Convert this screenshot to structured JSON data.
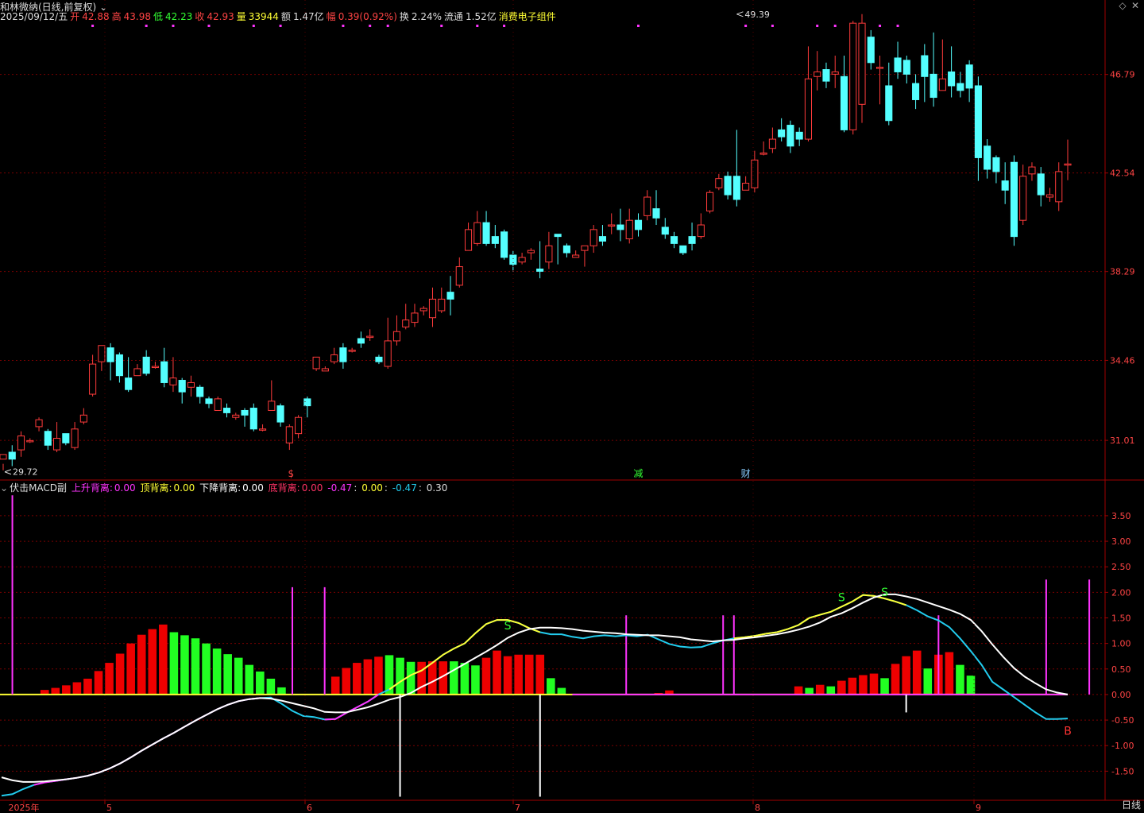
{
  "header": {
    "stock_name": "和林微纳(日线,前复权)",
    "date": "2025/09/12/五",
    "open_label": "开",
    "open": "42.88",
    "high_label": "高",
    "high": "43.98",
    "low_label": "低",
    "low": "42.23",
    "close_label": "收",
    "close": "42.93",
    "vol_label": "量",
    "vol": "33944",
    "amt_label": "额",
    "amt": "1.47亿",
    "chg_label": "幅",
    "chg": "0.39(0.92%)",
    "turn_label": "换",
    "turn": "2.24%",
    "float_label": "流通",
    "float": "1.52亿",
    "sector": "消费电子组件"
  },
  "indicator": {
    "name": "伏击MACD副",
    "up_div_label": "上升背离:",
    "up_div": "0.00",
    "top_div_label": "顶背离:",
    "top_div": "0.00",
    "down_div_label": "下降背离:",
    "down_div": "0.00",
    "bottom_div_label": "底背离:",
    "bottom_div": "0.00",
    "v1": "-0.47",
    "v2": "0.00",
    "v3": "-0.47",
    "v4": "0.30"
  },
  "period_label": "日线",
  "colors": {
    "up": "#ff3b3b",
    "down": "#54ffff",
    "grid": "#7a0000",
    "axis_text": "#ff4444",
    "line_white": "#ffffff",
    "line_cyan": "#22ccee",
    "line_magenta": "#ff33ff",
    "line_yellow": "#ffff33",
    "bar_green": "#22ff22",
    "bar_red": "#ee0000"
  },
  "chart_data": [
    {
      "type": "candlestick",
      "title": "和林微纳(日线,前复权)",
      "y_ticks": [
        31.01,
        34.46,
        38.29,
        42.54,
        46.79
      ],
      "ylim": [
        29.3,
        50.0
      ],
      "x_ticks": [
        "2025年",
        "5",
        "6",
        "7",
        "8",
        "9"
      ],
      "annotations": [
        {
          "text": "49.39",
          "kind": "max"
        },
        {
          "text": "29.72",
          "kind": "min"
        },
        {
          "text": "$",
          "kind": "event"
        },
        {
          "text": "减",
          "kind": "event"
        },
        {
          "text": "财",
          "kind": "event"
        }
      ],
      "candles": [
        [
          30.2,
          30.4,
          29.72,
          30.0
        ],
        [
          30.5,
          30.2,
          29.9,
          30.8
        ],
        [
          30.6,
          31.2,
          30.3,
          31.4
        ],
        [
          31.0,
          31.0,
          30.9,
          31.1
        ],
        [
          31.6,
          31.9,
          31.4,
          32.0
        ],
        [
          31.4,
          30.8,
          30.6,
          31.5
        ],
        [
          30.6,
          31.1,
          30.5,
          31.8
        ],
        [
          31.3,
          30.9,
          30.8,
          31.3
        ],
        [
          30.7,
          31.5,
          30.6,
          31.8
        ],
        [
          31.8,
          32.1,
          31.7,
          32.4
        ],
        [
          33.0,
          34.3,
          32.9,
          34.7
        ],
        [
          34.4,
          35.1,
          34.0,
          35.1
        ],
        [
          35.0,
          34.4,
          33.6,
          35.2
        ],
        [
          34.7,
          33.8,
          33.5,
          34.8
        ],
        [
          33.7,
          33.2,
          33.1,
          34.6
        ],
        [
          33.8,
          34.1,
          33.8,
          34.3
        ],
        [
          34.6,
          33.9,
          33.8,
          34.9
        ],
        [
          34.2,
          34.2,
          34.1,
          34.4
        ],
        [
          34.4,
          33.5,
          33.3,
          35.0
        ],
        [
          33.4,
          33.7,
          33.1,
          34.6
        ],
        [
          33.6,
          33.1,
          32.6,
          33.7
        ],
        [
          33.3,
          33.5,
          32.9,
          33.8
        ],
        [
          33.3,
          32.9,
          32.6,
          33.4
        ],
        [
          32.8,
          32.6,
          32.4,
          32.9
        ],
        [
          32.3,
          32.8,
          32.3,
          32.9
        ],
        [
          32.4,
          32.2,
          32.0,
          32.6
        ],
        [
          32.0,
          32.1,
          31.9,
          32.2
        ],
        [
          32.3,
          32.1,
          31.6,
          32.4
        ],
        [
          32.4,
          31.5,
          31.4,
          32.6
        ],
        [
          31.5,
          31.5,
          31.4,
          31.7
        ],
        [
          32.3,
          32.7,
          32.3,
          33.6
        ],
        [
          32.5,
          31.8,
          31.6,
          32.6
        ],
        [
          30.9,
          31.6,
          30.6,
          31.7
        ],
        [
          31.3,
          32.0,
          31.1,
          32.1
        ],
        [
          32.8,
          32.5,
          32.0,
          32.9
        ],
        [
          34.1,
          34.6,
          34.0,
          34.6
        ],
        [
          34.0,
          34.1,
          34.0,
          34.2
        ],
        [
          34.4,
          34.7,
          34.3,
          35.0
        ],
        [
          35.0,
          34.4,
          34.1,
          35.2
        ],
        [
          34.9,
          34.9,
          34.8,
          35.0
        ],
        [
          35.4,
          35.2,
          35.0,
          35.7
        ],
        [
          35.5,
          35.5,
          35.3,
          35.8
        ],
        [
          34.6,
          34.4,
          34.3,
          34.7
        ],
        [
          34.2,
          35.3,
          34.1,
          36.3
        ],
        [
          35.3,
          35.7,
          35.1,
          36.4
        ],
        [
          35.9,
          36.2,
          35.8,
          36.9
        ],
        [
          36.1,
          36.5,
          35.9,
          36.9
        ],
        [
          36.6,
          36.7,
          36.4,
          36.8
        ],
        [
          36.3,
          37.1,
          35.9,
          37.6
        ],
        [
          36.6,
          37.1,
          36.5,
          37.6
        ],
        [
          37.4,
          37.1,
          36.4,
          38.1
        ],
        [
          37.7,
          38.5,
          37.6,
          38.9
        ],
        [
          39.2,
          40.1,
          39.2,
          40.4
        ],
        [
          39.5,
          40.4,
          39.4,
          40.9
        ],
        [
          40.4,
          39.5,
          39.4,
          40.9
        ],
        [
          39.8,
          39.5,
          39.3,
          40.3
        ],
        [
          40.0,
          38.9,
          38.8,
          40.1
        ],
        [
          39.0,
          38.6,
          38.3,
          39.2
        ],
        [
          38.7,
          38.9,
          38.6,
          39.1
        ],
        [
          39.1,
          39.2,
          38.8,
          39.3
        ],
        [
          38.4,
          38.3,
          38.0,
          39.6
        ],
        [
          38.7,
          39.4,
          38.4,
          40.0
        ],
        [
          39.9,
          39.8,
          38.6,
          39.8
        ],
        [
          39.4,
          39.1,
          38.9,
          39.5
        ],
        [
          38.9,
          39.0,
          38.9,
          39.2
        ],
        [
          39.2,
          39.4,
          38.5,
          39.3
        ],
        [
          39.4,
          40.1,
          39.1,
          40.3
        ],
        [
          39.8,
          39.6,
          39.4,
          40.3
        ],
        [
          40.3,
          40.3,
          39.9,
          40.8
        ],
        [
          40.3,
          40.1,
          39.6,
          41.0
        ],
        [
          39.7,
          40.5,
          39.5,
          41.0
        ],
        [
          40.5,
          40.1,
          39.8,
          40.8
        ],
        [
          40.7,
          41.5,
          40.5,
          41.8
        ],
        [
          41.0,
          40.6,
          40.3,
          41.8
        ],
        [
          40.2,
          39.9,
          39.7,
          40.6
        ],
        [
          39.8,
          39.5,
          39.3,
          40.0
        ],
        [
          39.4,
          39.1,
          39.0,
          39.4
        ],
        [
          39.8,
          39.5,
          39.2,
          40.4
        ],
        [
          39.8,
          40.3,
          39.7,
          40.8
        ],
        [
          40.9,
          41.7,
          40.8,
          41.8
        ],
        [
          41.9,
          42.3,
          41.8,
          42.5
        ],
        [
          42.4,
          41.6,
          41.4,
          42.6
        ],
        [
          42.4,
          41.4,
          41.1,
          44.4
        ],
        [
          41.8,
          42.1,
          41.8,
          42.4
        ],
        [
          41.9,
          43.1,
          41.7,
          43.5
        ],
        [
          43.4,
          43.4,
          43.3,
          43.9
        ],
        [
          43.6,
          44.0,
          43.4,
          44.5
        ],
        [
          44.4,
          44.1,
          43.9,
          44.9
        ],
        [
          44.6,
          43.7,
          43.4,
          44.8
        ],
        [
          44.3,
          44.0,
          43.7,
          44.5
        ],
        [
          44.0,
          46.6,
          43.9,
          48.0
        ],
        [
          46.7,
          46.9,
          46.1,
          47.8
        ],
        [
          47.0,
          46.5,
          46.2,
          47.3
        ],
        [
          46.8,
          46.9,
          46.2,
          47.6
        ],
        [
          46.7,
          44.4,
          44.3,
          47.6
        ],
        [
          44.4,
          49.0,
          44.2,
          49.1
        ],
        [
          45.5,
          49.0,
          44.7,
          49.39
        ],
        [
          48.4,
          47.3,
          47.0,
          48.7
        ],
        [
          47.1,
          47.1,
          45.5,
          47.6
        ],
        [
          46.3,
          44.8,
          44.6,
          47.3
        ],
        [
          47.5,
          46.9,
          46.6,
          48.2
        ],
        [
          47.4,
          46.8,
          46.4,
          47.6
        ],
        [
          46.4,
          45.7,
          45.3,
          46.8
        ],
        [
          47.6,
          46.7,
          45.6,
          48.1
        ],
        [
          46.8,
          45.8,
          45.4,
          48.6
        ],
        [
          46.1,
          46.6,
          46.1,
          48.3
        ],
        [
          46.9,
          46.3,
          45.8,
          48.0
        ],
        [
          46.4,
          46.1,
          45.8,
          46.9
        ],
        [
          47.2,
          46.2,
          45.6,
          47.4
        ],
        [
          46.3,
          43.2,
          42.2,
          46.7
        ],
        [
          43.7,
          42.7,
          42.3,
          44.0
        ],
        [
          43.2,
          42.6,
          42.1,
          43.3
        ],
        [
          42.2,
          41.8,
          41.2,
          43.0
        ],
        [
          43.0,
          39.8,
          39.4,
          43.3
        ],
        [
          40.5,
          42.4,
          40.3,
          42.9
        ],
        [
          42.5,
          42.8,
          42.2,
          43.0
        ],
        [
          42.5,
          41.6,
          41.1,
          42.8
        ],
        [
          41.5,
          41.6,
          41.3,
          41.9
        ],
        [
          41.3,
          42.6,
          40.9,
          43.0
        ],
        [
          42.88,
          42.93,
          42.23,
          43.98
        ]
      ]
    },
    {
      "type": "macd",
      "title": "伏击MACD副",
      "y_ticks": [
        -1.5,
        -1.0,
        -0.5,
        0.0,
        0.5,
        1.0,
        1.5,
        2.0,
        2.5,
        3.0,
        3.5
      ],
      "ylim": [
        -2.07,
        3.95
      ],
      "annotations": [
        "S",
        "S",
        "S",
        "B"
      ],
      "n": 100,
      "diff_white": [
        -1.62,
        -1.68,
        -1.71,
        -1.71,
        -1.7,
        -1.68,
        -1.66,
        -1.63,
        -1.59,
        -1.53,
        -1.45,
        -1.35,
        -1.23,
        -1.1,
        -0.98,
        -0.86,
        -0.75,
        -0.63,
        -0.51,
        -0.4,
        -0.29,
        -0.2,
        -0.13,
        -0.09,
        -0.07,
        -0.08,
        -0.12,
        -0.17,
        -0.22,
        -0.27,
        -0.34,
        -0.35,
        -0.35,
        -0.3,
        -0.25,
        -0.18,
        -0.1,
        -0.05,
        0.03,
        0.15,
        0.25,
        0.36,
        0.48,
        0.6,
        0.72,
        0.84,
        0.97,
        1.11,
        1.21,
        1.28,
        1.31,
        1.31,
        1.3,
        1.28,
        1.25,
        1.23,
        1.21,
        1.2,
        1.18,
        1.17,
        1.16,
        1.16,
        1.14,
        1.12,
        1.08,
        1.06,
        1.04,
        1.06,
        1.07,
        1.1,
        1.12,
        1.15,
        1.18,
        1.22,
        1.27,
        1.33,
        1.41,
        1.52,
        1.59,
        1.69,
        1.8,
        1.9,
        1.96,
        1.96,
        1.92,
        1.87,
        1.8,
        1.73,
        1.66,
        1.58,
        1.46,
        1.24,
        0.98,
        0.74,
        0.52,
        0.35,
        0.22,
        0.1,
        0.04,
        0.0
      ],
      "dea_cyan": [
        -1.98,
        -1.95,
        -1.85,
        -1.77,
        -1.72,
        -1.69,
        -1.66,
        -1.63,
        -1.59,
        -1.53,
        -1.45,
        -1.35,
        -1.23,
        -1.1,
        -0.98,
        -0.86,
        -0.75,
        -0.63,
        -0.51,
        -0.4,
        -0.29,
        -0.2,
        -0.13,
        -0.09,
        -0.07,
        -0.06,
        -0.18,
        -0.32,
        -0.42,
        -0.44,
        -0.49,
        -0.48,
        -0.36,
        -0.25,
        -0.14,
        0.0,
        0.1,
        0.25,
        0.38,
        0.47,
        0.62,
        0.78,
        0.9,
        1.0,
        1.2,
        1.38,
        1.46,
        1.46,
        1.4,
        1.3,
        1.22,
        1.18,
        1.18,
        1.13,
        1.1,
        1.14,
        1.16,
        1.14,
        1.16,
        1.14,
        1.17,
        1.08,
        0.99,
        0.94,
        0.92,
        0.93,
        1.0,
        1.06,
        1.1,
        1.12,
        1.15,
        1.19,
        1.22,
        1.28,
        1.36,
        1.5,
        1.56,
        1.62,
        1.72,
        1.82,
        1.95,
        1.93,
        1.88,
        1.82,
        1.75,
        1.65,
        1.53,
        1.45,
        1.32,
        1.1,
        0.85,
        0.58,
        0.25,
        0.1,
        -0.05,
        -0.2,
        -0.35,
        -0.48,
        -0.48,
        -0.47
      ],
      "hist": [
        0.0,
        0.0,
        0.0,
        0.0,
        0.09,
        0.13,
        0.18,
        0.24,
        0.31,
        0.46,
        0.62,
        0.8,
        1.0,
        1.17,
        1.28,
        1.37,
        1.22,
        1.16,
        1.1,
        1.0,
        0.9,
        0.79,
        0.72,
        0.58,
        0.45,
        0.31,
        0.14,
        0.0,
        0.0,
        0.0,
        0.0,
        0.35,
        0.52,
        0.62,
        0.69,
        0.74,
        0.77,
        0.72,
        0.64,
        0.64,
        0.65,
        0.65,
        0.65,
        0.62,
        0.57,
        0.72,
        0.86,
        0.75,
        0.78,
        0.78,
        0.78,
        0.32,
        0.13,
        0.0,
        0.0,
        0.0,
        0.0,
        0.0,
        0.0,
        0.0,
        0.0,
        0.03,
        0.08,
        0.0,
        0.0,
        0.0,
        0.0,
        0.0,
        0.0,
        0.0,
        0.0,
        0.0,
        0.0,
        0.0,
        0.16,
        0.13,
        0.19,
        0.16,
        0.27,
        0.33,
        0.38,
        0.41,
        0.32,
        0.6,
        0.75,
        0.86,
        0.51,
        0.78,
        0.83,
        0.58,
        0.37,
        0.0,
        0.0,
        0.0,
        0.0,
        0.0,
        0.0,
        0.0,
        0.0,
        0.0
      ],
      "hist_color": [
        "n",
        "n",
        "n",
        "n",
        "r",
        "r",
        "r",
        "r",
        "r",
        "r",
        "r",
        "r",
        "r",
        "r",
        "r",
        "r",
        "g",
        "g",
        "g",
        "g",
        "g",
        "g",
        "g",
        "g",
        "g",
        "g",
        "g",
        "n",
        "n",
        "n",
        "n",
        "r",
        "r",
        "r",
        "r",
        "r",
        "g",
        "g",
        "g",
        "r",
        "r",
        "r",
        "g",
        "g",
        "g",
        "r",
        "r",
        "r",
        "r",
        "r",
        "r",
        "g",
        "g",
        "n",
        "n",
        "n",
        "n",
        "n",
        "n",
        "n",
        "n",
        "r",
        "r",
        "n",
        "n",
        "n",
        "n",
        "n",
        "n",
        "n",
        "n",
        "n",
        "n",
        "n",
        "r",
        "g",
        "r",
        "g",
        "r",
        "r",
        "r",
        "r",
        "g",
        "r",
        "r",
        "r",
        "g",
        "r",
        "r",
        "g",
        "g",
        "n",
        "n",
        "n",
        "n",
        "n",
        "n",
        "n",
        "n",
        "n"
      ],
      "magenta_spikes": [
        1,
        27,
        30,
        58,
        67,
        68,
        87,
        97,
        101
      ],
      "white_drops": [
        37,
        50,
        84
      ]
    }
  ]
}
